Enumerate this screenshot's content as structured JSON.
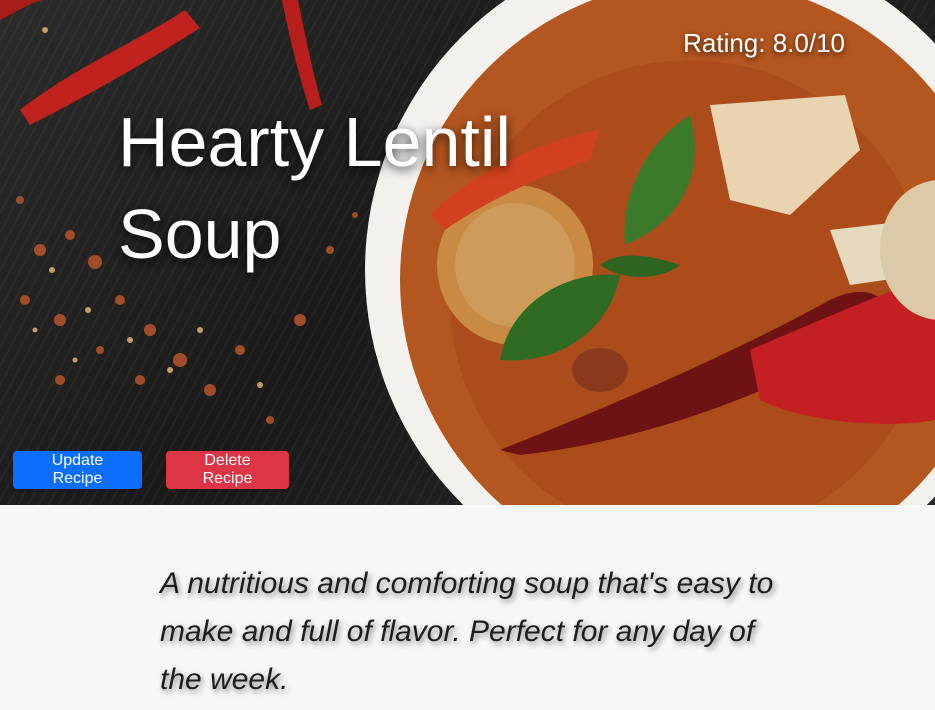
{
  "recipe": {
    "rating_text": "Rating: 8.0/10",
    "title": "Hearty Lentil Soup",
    "description": "A nutritious and comforting soup that's easy to make and full of flavor. Perfect for any day of the week."
  },
  "actions": {
    "update_label": "Update Recipe",
    "delete_label": "Delete Recipe"
  },
  "colors": {
    "update_button": "#0d6efd",
    "delete_button": "#dc3545",
    "page_background": "#f7f7f7"
  }
}
